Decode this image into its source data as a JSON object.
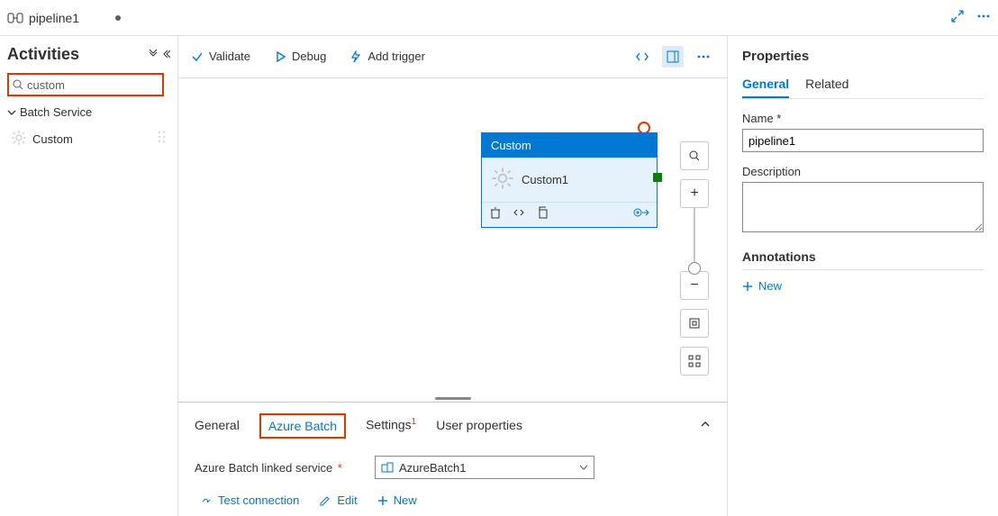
{
  "header": {
    "pipeline_name": "pipeline1"
  },
  "sidebar": {
    "title": "Activities",
    "search_value": "custom",
    "category_label": "Batch Service",
    "activity_item": "Custom"
  },
  "toolbar": {
    "validate": "Validate",
    "debug": "Debug",
    "add_trigger": "Add trigger"
  },
  "node": {
    "type_label": "Custom",
    "name": "Custom1"
  },
  "bottom": {
    "tabs": {
      "general": "General",
      "azure_batch": "Azure Batch",
      "settings": "Settings",
      "user_properties": "User properties"
    },
    "settings_badge": "1",
    "linked_service_label": "Azure Batch linked service",
    "linked_service_value": "AzureBatch1",
    "test_connection": "Test connection",
    "edit": "Edit",
    "new": "New"
  },
  "properties": {
    "title": "Properties",
    "tabs": {
      "general": "General",
      "related": "Related"
    },
    "name_label": "Name",
    "name_value": "pipeline1",
    "description_label": "Description",
    "annotations_label": "Annotations",
    "new_label": "New"
  }
}
